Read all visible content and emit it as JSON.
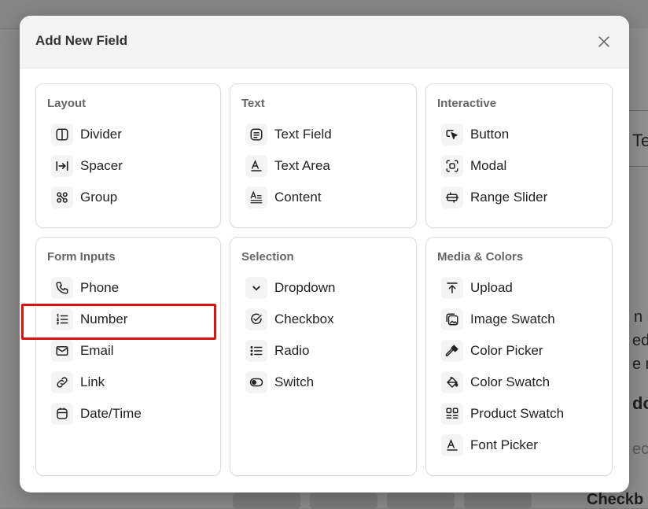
{
  "dialog": {
    "title": "Add New Field",
    "close_label": "×"
  },
  "background": {
    "fragments": [
      "Te",
      "n ip",
      "ed",
      "e m",
      "do",
      "ect",
      "Checkb"
    ]
  },
  "highlight_color": "#e01010",
  "groups": [
    {
      "title": "Layout",
      "items": [
        {
          "label": "Divider",
          "icon": "divider-icon"
        },
        {
          "label": "Spacer",
          "icon": "spacer-icon"
        },
        {
          "label": "Group",
          "icon": "group-icon"
        }
      ]
    },
    {
      "title": "Text",
      "items": [
        {
          "label": "Text Field",
          "icon": "text-field-icon"
        },
        {
          "label": "Text Area",
          "icon": "text-area-icon"
        },
        {
          "label": "Content",
          "icon": "content-icon"
        }
      ]
    },
    {
      "title": "Interactive",
      "items": [
        {
          "label": "Button",
          "icon": "button-cursor-icon"
        },
        {
          "label": "Modal",
          "icon": "modal-icon"
        },
        {
          "label": "Range Slider",
          "icon": "range-slider-icon"
        }
      ]
    },
    {
      "title": "Form Inputs",
      "items": [
        {
          "label": "Phone",
          "icon": "phone-icon"
        },
        {
          "label": "Number",
          "icon": "numbered-list-icon"
        },
        {
          "label": "Email",
          "icon": "email-icon"
        },
        {
          "label": "Link",
          "icon": "link-icon"
        },
        {
          "label": "Date/Time",
          "icon": "calendar-icon"
        }
      ]
    },
    {
      "title": "Selection",
      "items": [
        {
          "label": "Dropdown",
          "icon": "chevron-down-icon"
        },
        {
          "label": "Checkbox",
          "icon": "check-circle-icon"
        },
        {
          "label": "Radio",
          "icon": "list-icon"
        },
        {
          "label": "Switch",
          "icon": "toggle-icon"
        }
      ]
    },
    {
      "title": "Media & Colors",
      "items": [
        {
          "label": "Upload",
          "icon": "upload-icon"
        },
        {
          "label": "Image Swatch",
          "icon": "image-swatch-icon"
        },
        {
          "label": "Color Picker",
          "icon": "eyedropper-icon"
        },
        {
          "label": "Color Swatch",
          "icon": "paint-bucket-icon"
        },
        {
          "label": "Product Swatch",
          "icon": "product-swatch-icon"
        },
        {
          "label": "Font Picker",
          "icon": "font-icon"
        }
      ]
    }
  ]
}
